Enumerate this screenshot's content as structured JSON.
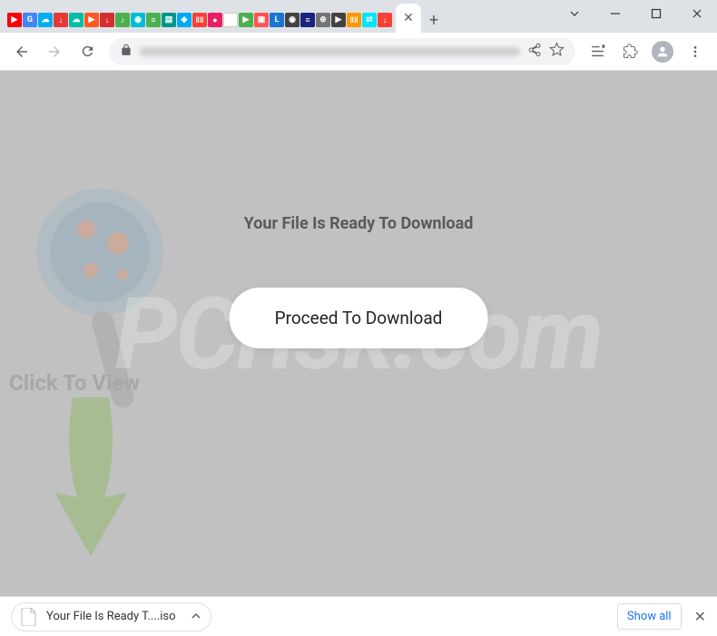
{
  "window": {
    "extensions": [
      {
        "bg": "#ff0000",
        "glyph": "▶"
      },
      {
        "bg": "#4285f4",
        "glyph": "G"
      },
      {
        "bg": "#00aeef",
        "glyph": "☁"
      },
      {
        "bg": "#e53935",
        "glyph": "↓"
      },
      {
        "bg": "#00bfa5",
        "glyph": "☁"
      },
      {
        "bg": "#ff5722",
        "glyph": "▶"
      },
      {
        "bg": "#d32f2f",
        "glyph": "↓"
      },
      {
        "bg": "#4caf50",
        "glyph": "♪"
      },
      {
        "bg": "#00bcd4",
        "glyph": "◉"
      },
      {
        "bg": "#4caf50",
        "glyph": "≡"
      },
      {
        "bg": "#009688",
        "glyph": "▤"
      },
      {
        "bg": "#03a9f4",
        "glyph": "◈"
      },
      {
        "bg": "#f44336",
        "glyph": "ǁǁ"
      },
      {
        "bg": "#e91e63",
        "glyph": "●"
      },
      {
        "bg": "#ffffff",
        "glyph": ""
      },
      {
        "bg": "#4caf50",
        "glyph": "▶"
      },
      {
        "bg": "#ff5252",
        "glyph": "▣"
      },
      {
        "bg": "#1976d2",
        "glyph": "L"
      },
      {
        "bg": "#424242",
        "glyph": "◉"
      },
      {
        "bg": "#1a237e",
        "glyph": "≡"
      },
      {
        "bg": "#757575",
        "glyph": "⊕"
      },
      {
        "bg": "#424242",
        "glyph": "▶"
      },
      {
        "bg": "#ff9800",
        "glyph": "ǁǁ"
      },
      {
        "bg": "#00e5ff",
        "glyph": "⇄"
      },
      {
        "bg": "#f44336",
        "glyph": "↓"
      }
    ]
  },
  "page": {
    "heading": "Your File Is Ready To Download",
    "button": "Proceed To Download",
    "side_label": "Click To View",
    "watermark": "PCrisk.com"
  },
  "downloads": {
    "filename": "Your File Is Ready T....iso",
    "show_all": "Show all"
  }
}
